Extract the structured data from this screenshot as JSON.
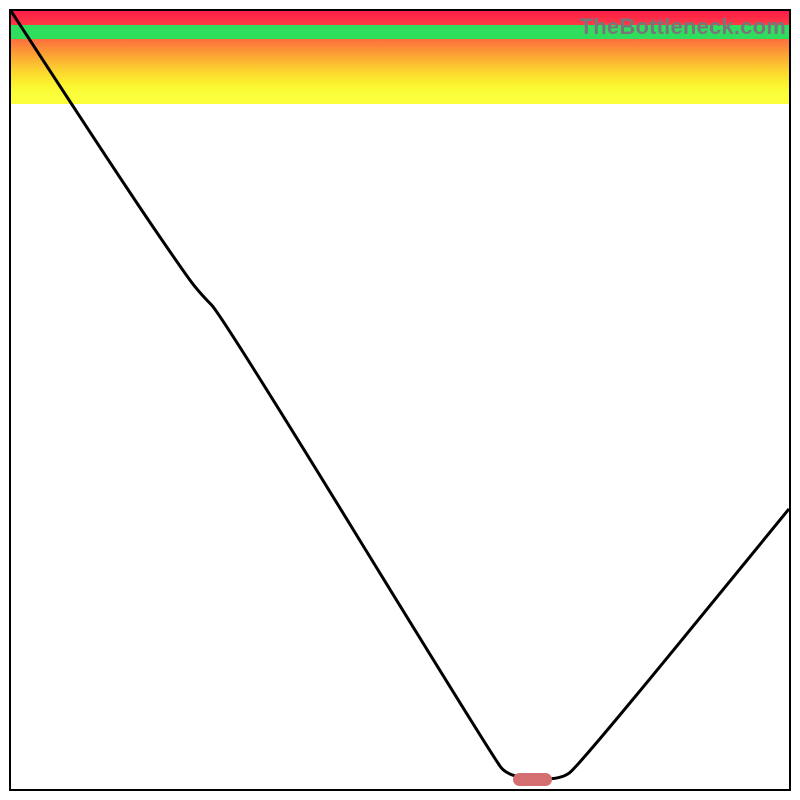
{
  "watermark": {
    "text": "TheBottleneck.com"
  },
  "chart_data": {
    "type": "line",
    "title": "",
    "xlabel": "",
    "ylabel": "",
    "xlim": [
      0,
      100
    ],
    "ylim": [
      0,
      100
    ],
    "grid": false,
    "legend": false,
    "background_gradient": {
      "stops": [
        {
          "pos": 0.0,
          "color": "#fe1c48"
        },
        {
          "pos": 0.15,
          "color": "#fe3b44"
        },
        {
          "pos": 0.3,
          "color": "#fd6e3e"
        },
        {
          "pos": 0.47,
          "color": "#fca235"
        },
        {
          "pos": 0.62,
          "color": "#fcce2f"
        },
        {
          "pos": 0.78,
          "color": "#fbf22d"
        },
        {
          "pos": 0.88,
          "color": "#fbfe3a"
        }
      ],
      "vertical_from": "top"
    },
    "bottom_band": {
      "yellowish_fade": {
        "from_y": 88,
        "to_y": 98,
        "from_color": "#fcfe69",
        "to_color": "#7aeb53"
      },
      "green_strip": {
        "from_y": 98.2,
        "to_y": 100,
        "color": "#30de5e"
      }
    },
    "series": [
      {
        "name": "curve",
        "points": [
          {
            "x": 0.0,
            "y": 100.0
          },
          {
            "x": 13.0,
            "y": 80.0
          },
          {
            "x": 22.5,
            "y": 66.0
          },
          {
            "x": 24.5,
            "y": 63.5
          },
          {
            "x": 27.0,
            "y": 61.0
          },
          {
            "x": 62.0,
            "y": 4.0
          },
          {
            "x": 64.0,
            "y": 1.5
          },
          {
            "x": 70.5,
            "y": 1.1
          },
          {
            "x": 73.0,
            "y": 3.0
          },
          {
            "x": 100.0,
            "y": 36.0
          }
        ]
      }
    ],
    "marker": {
      "x": 67.0,
      "y": 1.2,
      "w": 5.0,
      "h": 1.6,
      "color": "#d56e71"
    }
  }
}
